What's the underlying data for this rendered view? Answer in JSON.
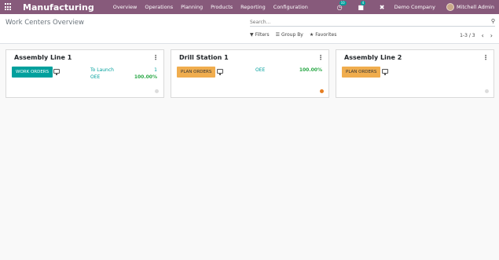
{
  "navbar": {
    "app_title": "Manufacturing",
    "menu": [
      "Overview",
      "Operations",
      "Planning",
      "Products",
      "Reporting",
      "Configuration"
    ],
    "activity_badge": "10",
    "messages_badge": "4",
    "company": "Demo Company",
    "user": "Mitchell Admin"
  },
  "control": {
    "breadcrumb": "Work Centers Overview",
    "search_placeholder": "Search...",
    "filters_label": "Filters",
    "groupby_label": "Group By",
    "favorites_label": "Favorites",
    "pager": "1-3 / 3"
  },
  "cards": [
    {
      "title": "Assembly Line 1",
      "button": "WORK ORDERS",
      "to_launch_label": "To Launch",
      "to_launch_value": "1",
      "oee_label": "OEE",
      "oee_value": "100.00%",
      "status_color": "#dddddd"
    },
    {
      "title": "Drill Station 1",
      "button": "PLAN ORDERS",
      "oee_label": "OEE",
      "oee_value": "100.00%",
      "status_color": "#e67e22"
    },
    {
      "title": "Assembly Line 2",
      "button": "PLAN ORDERS",
      "status_color": "#dddddd"
    }
  ]
}
